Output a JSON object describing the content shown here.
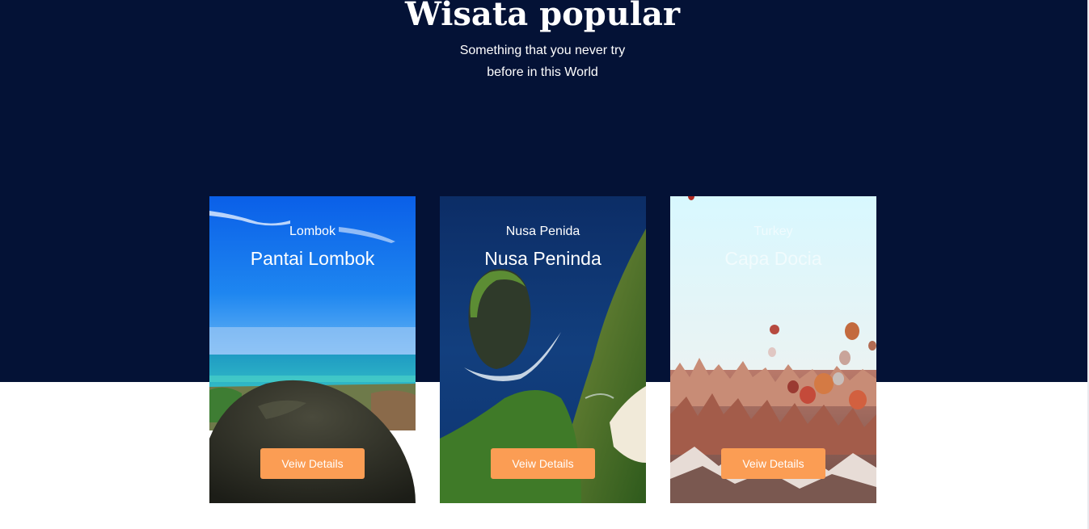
{
  "section": {
    "title": "Wisata popular",
    "subtitle_line1": "Something that you never try",
    "subtitle_line2": "before in this World"
  },
  "colors": {
    "hero_background": "#041236",
    "button": "#fb9d54",
    "text": "#ffffff"
  },
  "cards": [
    {
      "location": "Lombok",
      "name": "Pantai Lombok",
      "button_label": "Veiw Details"
    },
    {
      "location": "Nusa Penida",
      "name": "Nusa Peninda",
      "button_label": "Veiw Details"
    },
    {
      "location": "Turkey",
      "name": "Capa Docia",
      "button_label": "Veiw Details"
    }
  ]
}
